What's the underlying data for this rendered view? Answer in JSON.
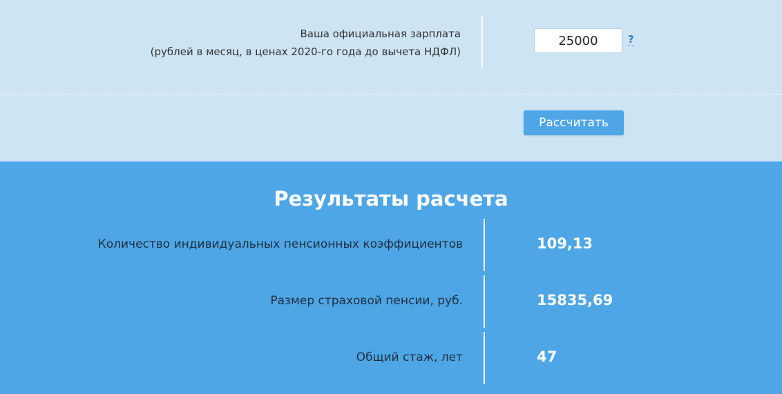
{
  "form": {
    "salary_label_line1": "Ваша официальная зарплата",
    "salary_label_line2": "(рублей в месяц, в ценах 2020-го года до вычета НДФЛ)",
    "salary_value": "25000",
    "help_label": "?",
    "calculate_label": "Рассчитать"
  },
  "results": {
    "title": "Результаты расчета",
    "rows": [
      {
        "label": "Количество индивидуальных пенсионных коэффициентов",
        "value": "109,13"
      },
      {
        "label": "Размер страховой пенсии, руб.",
        "value": "15835,69"
      },
      {
        "label": "Общий стаж, лет",
        "value": "47"
      }
    ]
  },
  "colors": {
    "top_background": "#cde4f4",
    "results_background": "#4ea6e6",
    "button_background": "#4ea6e6"
  }
}
